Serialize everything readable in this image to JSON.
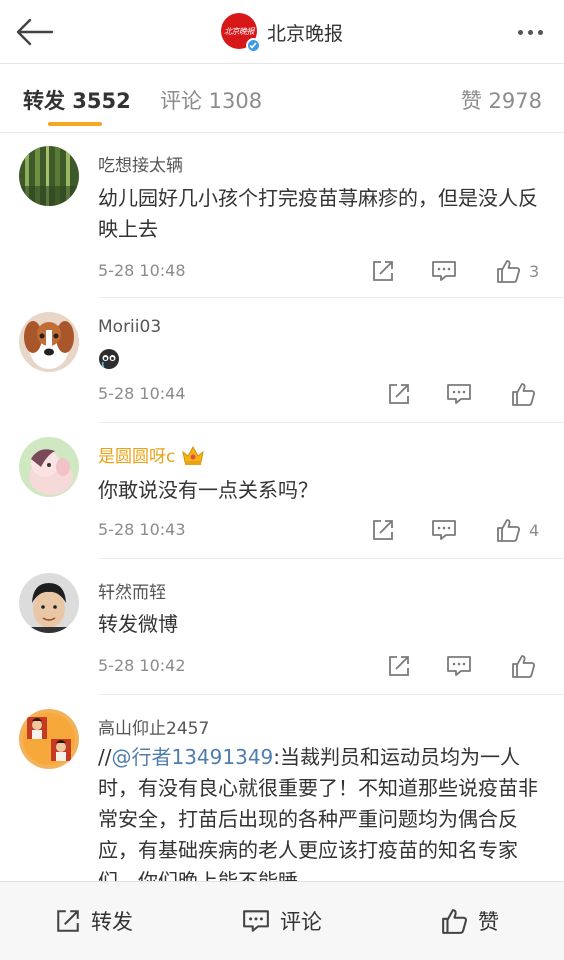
{
  "header": {
    "title": "北京晚报",
    "logo_text": "北京晚报"
  },
  "tabs": {
    "repost": "转发 3552",
    "comment": "评论 1308",
    "like": "赞 2978"
  },
  "reposts": [
    {
      "username": "吃想接太辆",
      "content": "幼儿园好几小孩个打完疫苗荨麻疹的，但是没人反映上去",
      "time": "5-28 10:48",
      "likes": "3"
    },
    {
      "username": "Morii03",
      "content_icon": "crying-emoji-icon",
      "time": "5-28 10:44",
      "likes": ""
    },
    {
      "username": "是圆圆呀c",
      "badge_icon": "crown-icon",
      "content": "你敢说没有一点关系吗？",
      "time": "5-28 10:43",
      "likes": "4"
    },
    {
      "username": "轩然而轾",
      "content": "转发微博",
      "time": "5-28 10:42",
      "likes": ""
    },
    {
      "username": "高山仰止2457",
      "content_prefix": "//",
      "mention": "@行者13491349",
      "content": ":当裁判员和运动员均为一人时，有没有良心就很重要了！不知道那些说疫苗非常安全，打苗后出现的各种严重问题均为偶合反应，有基础疾病的老人更应该打疫苗的知名专家们，你们晚上能不能睡"
    }
  ],
  "bottom_bar": {
    "repost": "转发",
    "comment": "评论",
    "like": "赞"
  },
  "colors": {
    "accent_tab": "#f5a623",
    "mention": "#507daf",
    "gold_username": "#e8a317",
    "brand_red": "#d71718",
    "verified_blue": "#3d9ae8"
  }
}
